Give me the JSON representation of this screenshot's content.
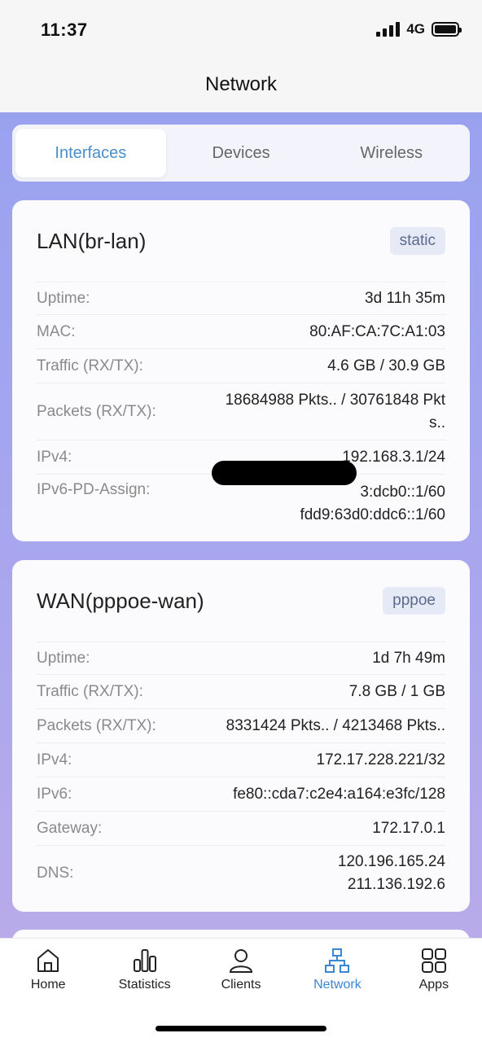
{
  "status": {
    "time": "11:37",
    "network": "4G"
  },
  "header": {
    "title": "Network"
  },
  "tabs": [
    {
      "label": "Interfaces",
      "active": true
    },
    {
      "label": "Devices",
      "active": false
    },
    {
      "label": "Wireless",
      "active": false
    }
  ],
  "lan": {
    "title": "LAN(br-lan)",
    "badge": "static",
    "rows": [
      {
        "label": "Uptime:",
        "value": [
          "3d 11h 35m"
        ]
      },
      {
        "label": "MAC:",
        "value": [
          "80:AF:CA:7C:A1:03"
        ]
      },
      {
        "label": "Traffic (RX/TX):",
        "value": [
          "4.6 GB / 30.9 GB"
        ]
      },
      {
        "label": "Packets (RX/TX):",
        "value": [
          "18684988 Pkts.. / 30761848 Pkt",
          "s.."
        ]
      },
      {
        "label": "IPv4:",
        "value": [
          "192.168.3.1/24"
        ]
      },
      {
        "label": "IPv6-PD-Assign:",
        "value": [
          "3:dcb0::1/60",
          "fdd9:63d0:ddc6::1/60"
        ]
      }
    ]
  },
  "wan": {
    "title": "WAN(pppoe-wan)",
    "badge": "pppoe",
    "rows": [
      {
        "label": "Uptime:",
        "value": [
          "1d 7h 49m"
        ]
      },
      {
        "label": "Traffic (RX/TX):",
        "value": [
          "7.8 GB / 1 GB"
        ]
      },
      {
        "label": "Packets (RX/TX):",
        "value": [
          "8331424 Pkts.. / 4213468 Pkts.."
        ]
      },
      {
        "label": "IPv4:",
        "value": [
          "172.17.228.221/32"
        ]
      },
      {
        "label": "IPv6:",
        "value": [
          "fe80::cda7:c2e4:a164:e3fc/128"
        ]
      },
      {
        "label": "Gateway:",
        "value": [
          "172.17.0.1"
        ]
      },
      {
        "label": "DNS:",
        "value": [
          "120.196.165.24",
          "211.136.192.6"
        ]
      }
    ]
  },
  "nav": [
    {
      "label": "Home",
      "icon": "home-icon",
      "active": false
    },
    {
      "label": "Statistics",
      "icon": "statistics-icon",
      "active": false
    },
    {
      "label": "Clients",
      "icon": "user-icon",
      "active": false
    },
    {
      "label": "Network",
      "icon": "network-icon",
      "active": true
    },
    {
      "label": "Apps",
      "icon": "apps-icon",
      "active": false
    }
  ],
  "colors": {
    "accent": "#3a86d6",
    "tab_active": "#4a8fcc",
    "gradient_top": "#9aa2ef",
    "gradient_bottom": "#b9abea"
  }
}
